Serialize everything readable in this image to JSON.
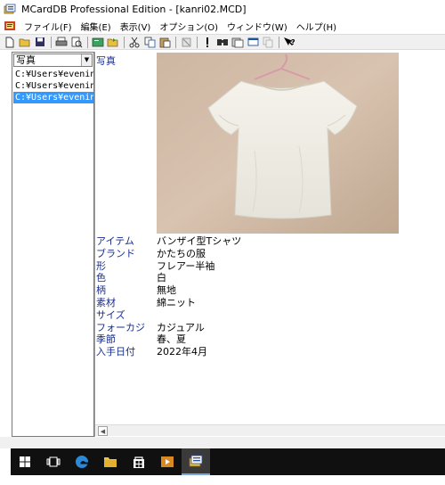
{
  "window": {
    "title": "MCardDB  Professional Edition - [kanri02.MCD]"
  },
  "menu": {
    "items": [
      "ファイル(F)",
      "編集(E)",
      "表示(V)",
      "オプション(O)",
      "ウィンドウ(W)",
      "ヘルプ(H)"
    ]
  },
  "toolbar": {
    "buttons": [
      "new-file-icon",
      "open-folder-icon",
      "save-icon",
      "print-icon",
      "print-preview-icon",
      "card-icon",
      "export-icon",
      "cut-icon",
      "copy-icon",
      "paste-icon",
      "delete-icon",
      "info-icon",
      "search-icon",
      "sort-icon",
      "window-icon",
      "copy-window-icon",
      "help-icon"
    ]
  },
  "leftpanel": {
    "combo_value": "写真",
    "files": [
      {
        "path": "C:¥Users¥evening",
        "selected": false
      },
      {
        "path": "C:¥Users¥evening",
        "selected": false
      },
      {
        "path": "C:¥Users¥evening",
        "selected": true
      }
    ]
  },
  "record": {
    "photo_label": "写真",
    "fields": [
      {
        "label": "アイテム",
        "value": "バンザイ型Tシャツ"
      },
      {
        "label": "ブランド",
        "value": "かたちの服"
      },
      {
        "label": "形",
        "value": "フレアー半袖"
      },
      {
        "label": "色",
        "value": "白"
      },
      {
        "label": "柄",
        "value": "無地"
      },
      {
        "label": "素材",
        "value": "綿ニット"
      },
      {
        "label": "サイズ",
        "value": ""
      },
      {
        "label": "フォーカジ",
        "value": "カジュアル"
      },
      {
        "label": "季節",
        "value": "春、夏"
      },
      {
        "label": "入手日付",
        "value": "2022年4月"
      }
    ]
  },
  "colors": {
    "field_label": "#1a2f8f",
    "selection": "#3399ff",
    "taskbar": "#101010"
  },
  "taskbar": {
    "icons": [
      "windows-start-icon",
      "task-view-icon",
      "edge-browser-icon",
      "file-explorer-icon",
      "store-icon",
      "media-player-icon",
      "mcarddb-app-icon"
    ]
  }
}
